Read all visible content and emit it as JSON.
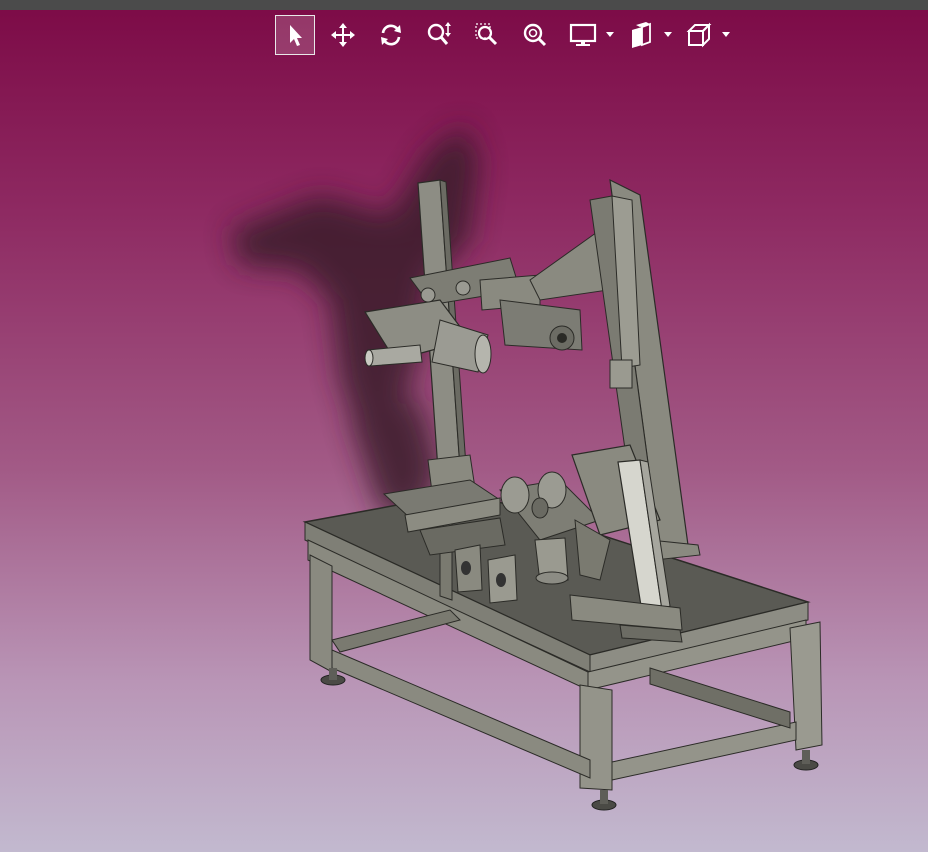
{
  "app": {
    "colors": {
      "gradient_top": "#7c0a46",
      "gradient_bottom": "#c2b9cf",
      "icon_color": "#ffffff",
      "model_gray": "#8a8a80",
      "model_dark": "#5d5d57"
    }
  },
  "toolbar": {
    "tools": [
      {
        "id": "select",
        "icon": "arrow-cursor-icon",
        "active": true
      },
      {
        "id": "pan",
        "icon": "move-arrows-icon",
        "active": false
      },
      {
        "id": "rotate",
        "icon": "rotate-icon",
        "active": false
      },
      {
        "id": "zoom",
        "icon": "zoom-updown-icon",
        "active": false
      },
      {
        "id": "zoom-window",
        "icon": "zoom-window-icon",
        "active": false
      },
      {
        "id": "zoom-fit",
        "icon": "zoom-fit-icon",
        "active": false
      }
    ],
    "dropdown_tools": [
      {
        "id": "display",
        "icon": "monitor-icon"
      },
      {
        "id": "section",
        "icon": "section-plane-icon"
      },
      {
        "id": "view",
        "icon": "cube-view-icon"
      }
    ]
  }
}
